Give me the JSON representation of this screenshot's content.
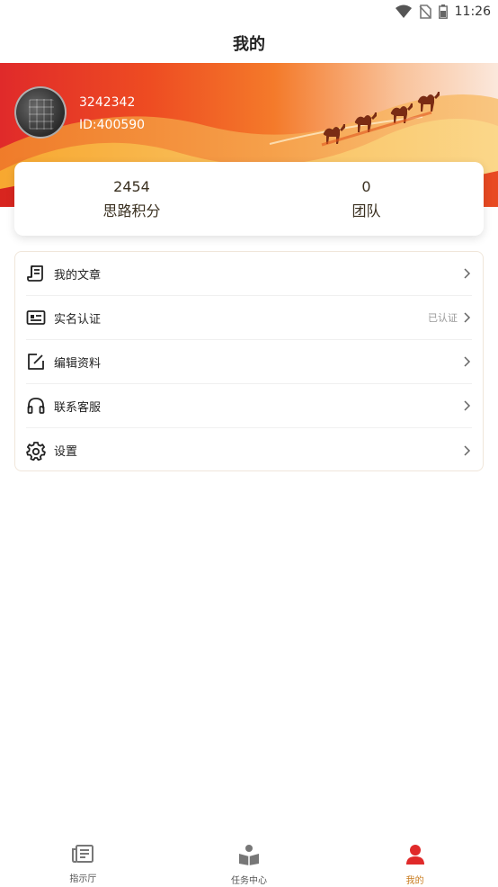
{
  "status_bar": {
    "time": "11:26"
  },
  "header": {
    "title": "我的"
  },
  "profile": {
    "name": "3242342",
    "id_text": "ID:400590"
  },
  "stats": [
    {
      "value": "2454",
      "label": "思路积分"
    },
    {
      "value": "0",
      "label": "团队"
    }
  ],
  "menu": [
    {
      "label": "我的文章",
      "extra": "",
      "icon": "article-icon"
    },
    {
      "label": "实名认证",
      "extra": "已认证",
      "icon": "id-card-icon"
    },
    {
      "label": "编辑资料",
      "extra": "",
      "icon": "edit-icon"
    },
    {
      "label": "联系客服",
      "extra": "",
      "icon": "headset-icon"
    },
    {
      "label": "设置",
      "extra": "",
      "icon": "gear-icon"
    }
  ],
  "bottom_nav": [
    {
      "label": "指示厅",
      "icon": "newspaper-icon",
      "active": false
    },
    {
      "label": "任务中心",
      "icon": "reader-icon",
      "active": false
    },
    {
      "label": "我的",
      "icon": "user-icon",
      "active": true
    }
  ],
  "colors": {
    "accent": "#e02a2a",
    "active_nav": "#c87a1c",
    "banner_end": "#fbe8dc"
  }
}
